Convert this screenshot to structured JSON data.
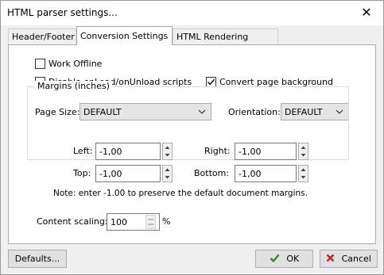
{
  "window": {
    "title": "HTML parser settings..."
  },
  "tabs": [
    {
      "label": "Header/Footer"
    },
    {
      "label": "Conversion Settings"
    },
    {
      "label": "HTML Rendering Engine"
    }
  ],
  "options": {
    "work_offline": {
      "label": "Work Offline",
      "checked": false
    },
    "disable_scripts": {
      "label": "Disable onLoad/onUnload scripts",
      "checked": false
    },
    "convert_background": {
      "label": "Convert page background",
      "checked": true
    }
  },
  "page_size": {
    "label": "Page Size:",
    "value": "DEFAULT"
  },
  "orientation": {
    "label": "Orientation:",
    "value": "DEFAULT"
  },
  "margins": {
    "title": "Margins (inches)",
    "left": {
      "label": "Left:",
      "value": "-1,00"
    },
    "right": {
      "label": "Right:",
      "value": "-1,00"
    },
    "top": {
      "label": "Top:",
      "value": "-1,00"
    },
    "bottom": {
      "label": "Bottom:",
      "value": "-1,00"
    },
    "note": "Note: enter -1.00 to preserve the default document margins."
  },
  "content_scaling": {
    "label": "Content scaling:",
    "value": "100",
    "unit": "%"
  },
  "buttons": {
    "defaults": "Defaults...",
    "ok": "OK",
    "cancel": "Cancel"
  },
  "colors": {
    "ok_check": "#2e8b1e",
    "cancel_x": "#c8201a"
  }
}
